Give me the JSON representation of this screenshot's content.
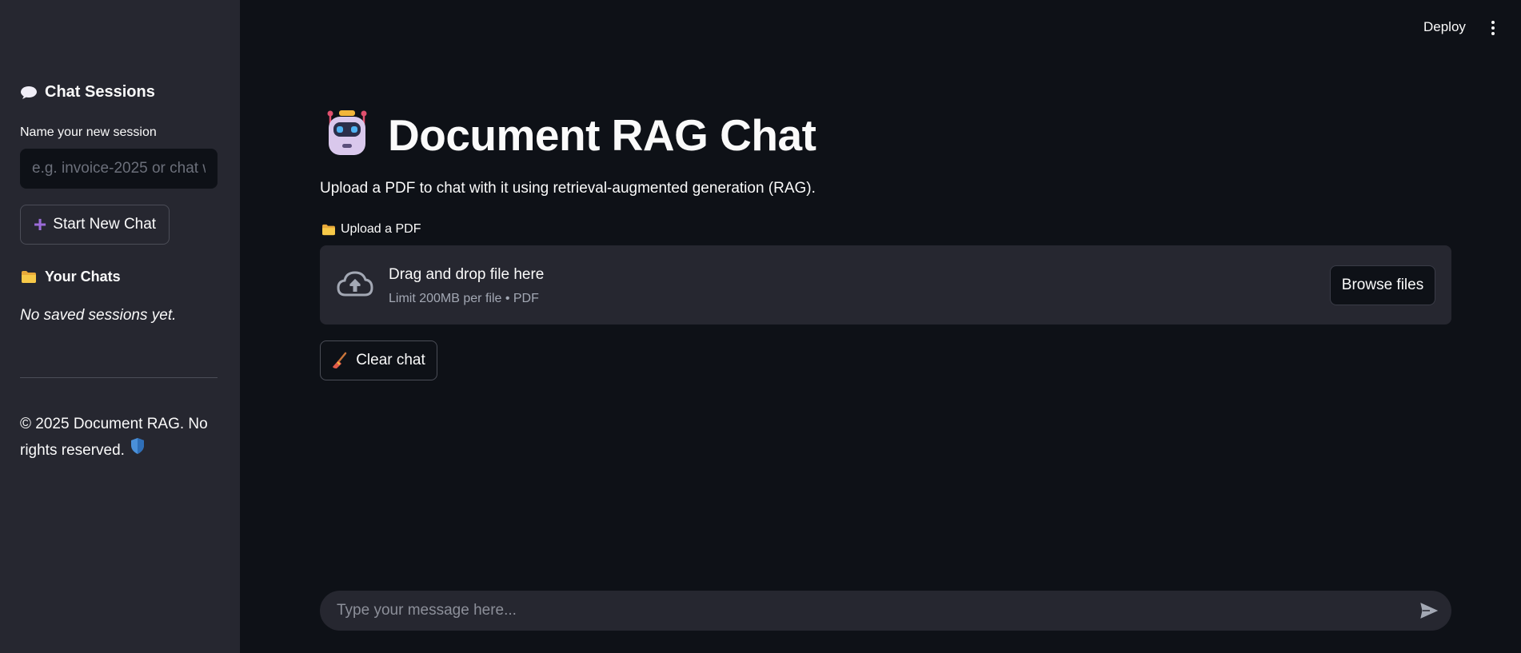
{
  "sidebar": {
    "heading": "Chat Sessions",
    "session_label": "Name your new session",
    "session_placeholder": "e.g. invoice-2025 or chat w",
    "new_chat_label": "Start New Chat",
    "chats_heading": "Your Chats",
    "empty_text": "No saved sessions yet.",
    "footer_line1": "© 2025 Document RAG. No",
    "footer_line2": "rights reserved."
  },
  "header": {
    "deploy_label": "Deploy"
  },
  "main": {
    "title": "Document RAG Chat",
    "subtitle": "Upload a PDF to chat with it using retrieval-augmented generation (RAG).",
    "upload_label": "Upload a PDF",
    "dropzone_title": "Drag and drop file here",
    "dropzone_sub": "Limit 200MB per file • PDF",
    "browse_label": "Browse files",
    "clear_label": "Clear chat",
    "chat_placeholder": "Type your message here..."
  },
  "icons": {
    "sessions": "speech-balloon-icon",
    "plus": "plus-icon",
    "chats": "folder-icon",
    "shield": "shield-icon",
    "robot": "robot-icon",
    "upload": "cloud-upload-icon",
    "clear": "broom-icon",
    "send": "send-icon",
    "menu": "kebab-menu-icon"
  },
  "colors": {
    "background": "#0e1117",
    "sidebar": "#262730",
    "accent_plus": "#9b6bd8"
  }
}
